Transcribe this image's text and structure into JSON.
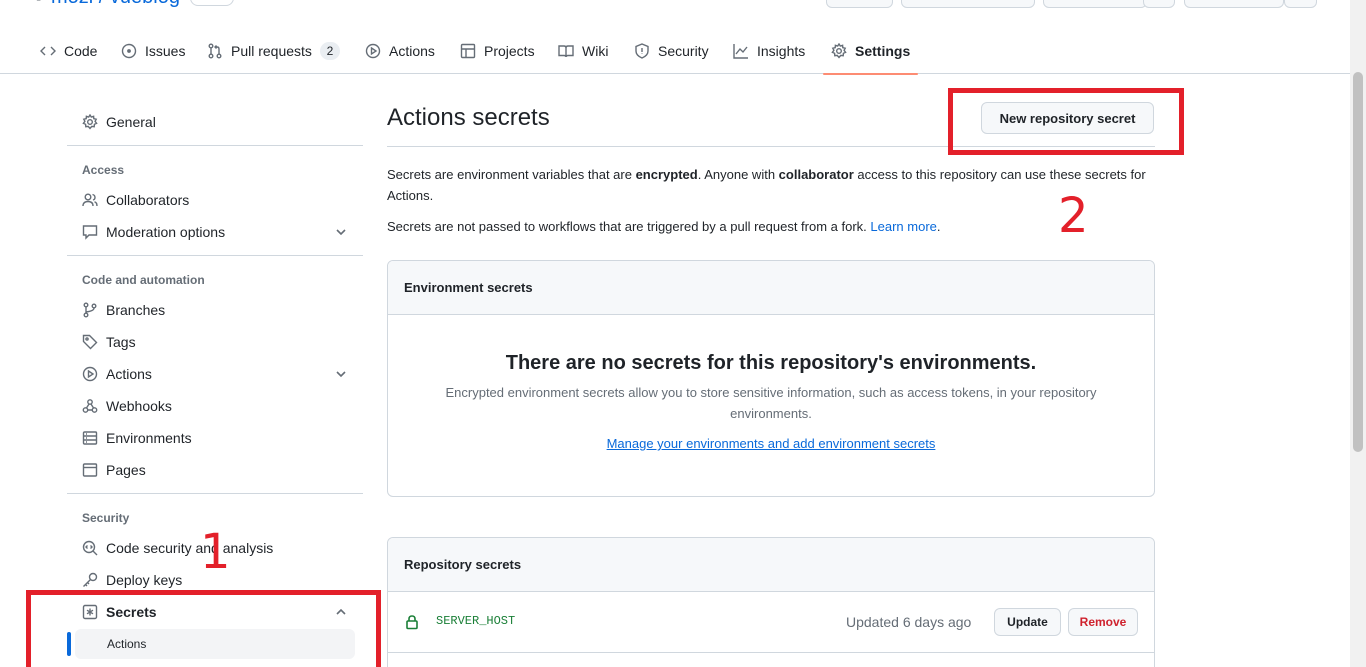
{
  "repo": {
    "owner": "mozi",
    "separator": "/",
    "name": "vueblog"
  },
  "tabs": [
    {
      "label": "Code",
      "icon": "code-icon"
    },
    {
      "label": "Issues",
      "icon": "issue-icon"
    },
    {
      "label": "Pull requests",
      "icon": "pull-request-icon",
      "count": "2"
    },
    {
      "label": "Actions",
      "icon": "play-icon"
    },
    {
      "label": "Projects",
      "icon": "table-icon"
    },
    {
      "label": "Wiki",
      "icon": "book-icon"
    },
    {
      "label": "Security",
      "icon": "shield-icon"
    },
    {
      "label": "Insights",
      "icon": "graph-icon"
    },
    {
      "label": "Settings",
      "icon": "gear-icon",
      "selected": true
    }
  ],
  "sidebar": {
    "general": "General",
    "access_heading": "Access",
    "collaborators": "Collaborators",
    "moderation": "Moderation options",
    "code_heading": "Code and automation",
    "branches": "Branches",
    "tags": "Tags",
    "actions": "Actions",
    "webhooks": "Webhooks",
    "environments": "Environments",
    "pages": "Pages",
    "security_heading": "Security",
    "code_security": "Code security and analysis",
    "deploy_keys": "Deploy keys",
    "secrets": "Secrets",
    "secrets_actions": "Actions"
  },
  "main": {
    "title": "Actions secrets",
    "new_secret_button": "New repository secret",
    "intro_1": "Secrets are environment variables that are ",
    "intro_bold_1": "encrypted",
    "intro_2": ". Anyone with ",
    "intro_bold_2": "collaborator",
    "intro_3": " access to this repository can use these secrets for Actions.",
    "fork_note": "Secrets are not passed to workflows that are triggered by a pull request from a fork. ",
    "learn_more": "Learn more",
    "fork_note_end": "."
  },
  "environment_secrets": {
    "header": "Environment secrets",
    "blank_title": "There are no secrets for this repository's environments.",
    "blank_text": "Encrypted environment secrets allow you to store sensitive information, such as access tokens, in your repository environments.",
    "manage_link": "Manage your environments and add environment secrets"
  },
  "repository_secrets": {
    "header": "Repository secrets",
    "rows": [
      {
        "name": "SERVER_HOST",
        "updated": "Updated 6 days ago",
        "update_label": "Update",
        "remove_label": "Remove"
      }
    ]
  },
  "annotations": {
    "step_1": "1",
    "step_2": "2",
    "color": "#e3202a"
  },
  "colors": {
    "accent": "#0969da",
    "selected_tab": "#fd8c73",
    "success": "#1a7f37",
    "danger": "#cf222e"
  }
}
